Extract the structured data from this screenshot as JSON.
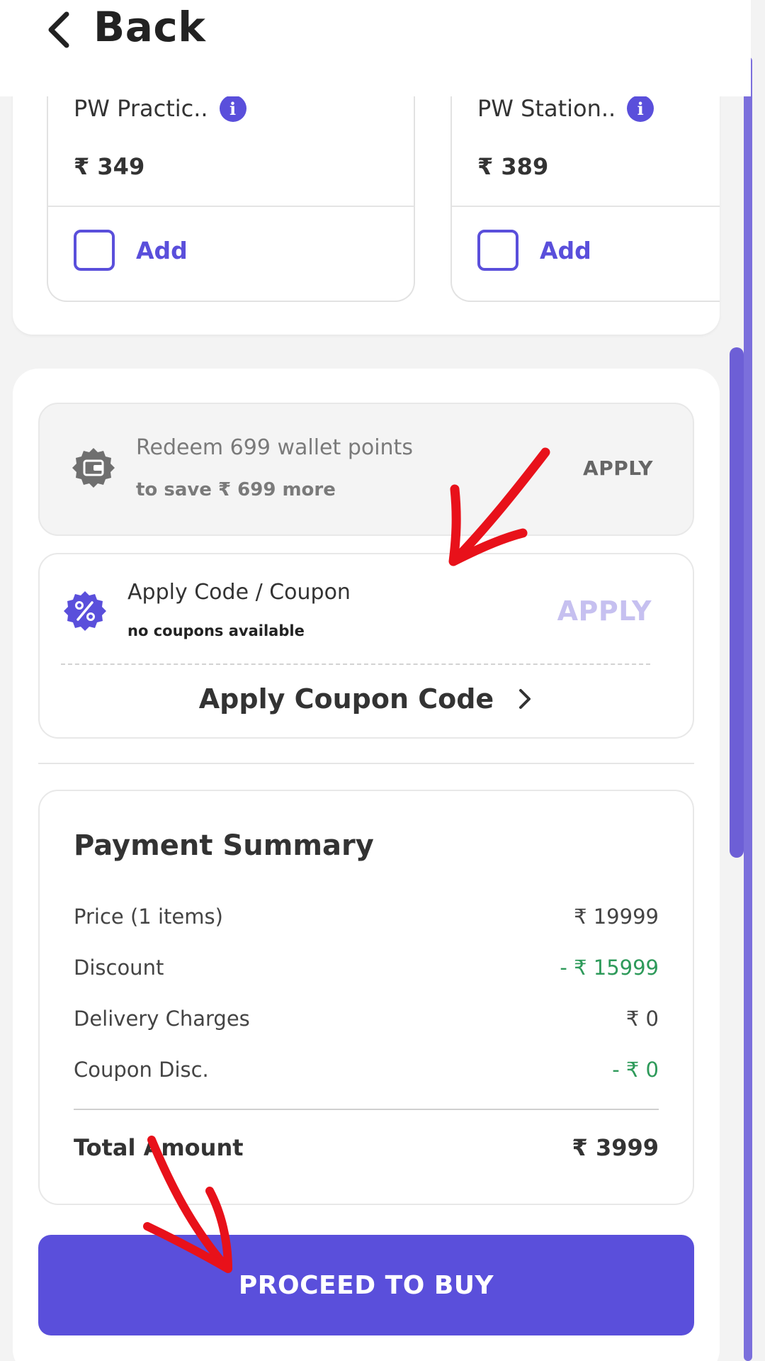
{
  "header": {
    "back_label": "Back"
  },
  "addons": [
    {
      "title": "PW Practic..",
      "price": "₹ 349",
      "add_label": "Add"
    },
    {
      "title": "PW Station..",
      "price": "₹ 389",
      "add_label": "Add"
    }
  ],
  "wallet": {
    "line1": "Redeem 699 wallet points",
    "line2": "to save ₹ 699 more",
    "apply_label": "APPLY"
  },
  "coupon": {
    "title": "Apply Code / Coupon",
    "subtitle": "no coupons available",
    "apply_label": "APPLY",
    "link_label": "Apply Coupon Code"
  },
  "summary": {
    "title": "Payment Summary",
    "rows": [
      {
        "label": "Price (1 items)",
        "value": "₹ 19999"
      },
      {
        "label": "Discount",
        "value": "- ₹ 15999"
      },
      {
        "label": "Delivery Charges",
        "value": "₹ 0"
      },
      {
        "label": "Coupon Disc.",
        "value": "- ₹ 0"
      }
    ],
    "total_label": "Total Amount",
    "total_value": "₹ 3999"
  },
  "cta": {
    "label": "PROCEED TO BUY"
  },
  "colors": {
    "accent": "#5a4fdb",
    "discount_green": "#2e9a5a",
    "annotation_red": "#e8111a"
  }
}
